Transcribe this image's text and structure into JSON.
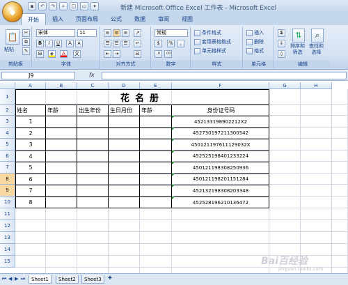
{
  "window": {
    "title": "新建 Microsoft Office Excel 工作表 - Microsoft Excel"
  },
  "tabs": [
    "开始",
    "插入",
    "页面布局",
    "公式",
    "数据",
    "审阅",
    "视图"
  ],
  "ribbon": {
    "clipboard": {
      "paste": "粘贴",
      "label": "剪贴板"
    },
    "font": {
      "name": "宋体",
      "size": "11",
      "label": "字体",
      "bold": "B",
      "italic": "I",
      "underline": "U",
      "grow": "A",
      "shrink": "A"
    },
    "alignment": {
      "label": "对齐方式"
    },
    "number": {
      "format": "常规",
      "percent": "%",
      "comma": ",",
      "label": "数字"
    },
    "styles": {
      "conditional": "条件格式",
      "table": "套用表格格式",
      "cell": "单元格样式",
      "label": "样式"
    },
    "cells": {
      "insert": "插入",
      "delete": "删除",
      "format": "格式",
      "label": "单元格"
    },
    "editing": {
      "sum": "Σ",
      "sort": "排序和",
      "sort2": "筛选",
      "find": "查找和",
      "find2": "选择",
      "label": "编辑"
    }
  },
  "formula_bar": {
    "name_box": "J9",
    "fx": "fx"
  },
  "columns": [
    "A",
    "B",
    "C",
    "D",
    "E",
    "F",
    "G",
    "H"
  ],
  "rows": [
    "1",
    "2",
    "3",
    "4",
    "5",
    "6",
    "7",
    "8",
    "9",
    "10",
    "11",
    "12",
    "13",
    "14",
    "15"
  ],
  "sheet": {
    "title": "花名册",
    "headers": [
      "姓名",
      "年龄",
      "出生年份",
      "生日月份",
      "年龄",
      "身份证号码"
    ],
    "records": [
      {
        "no": "1",
        "id": "452133198902212X2"
      },
      {
        "no": "2",
        "id": "452730197211300542"
      },
      {
        "no": "3",
        "id": "450121197611129032X"
      },
      {
        "no": "4",
        "id": "452525198401233224"
      },
      {
        "no": "5",
        "id": "450121198308250936"
      },
      {
        "no": "6",
        "id": "450121198201151284"
      },
      {
        "no": "7",
        "id": "452132198308203348"
      },
      {
        "no": "8",
        "id": "452528196210136472"
      }
    ]
  },
  "sheet_tabs": [
    "Sheet1",
    "Sheet2",
    "Sheet3"
  ],
  "watermark": {
    "brand": "Bai百经验",
    "sub": "jingyan.baidu.com"
  }
}
